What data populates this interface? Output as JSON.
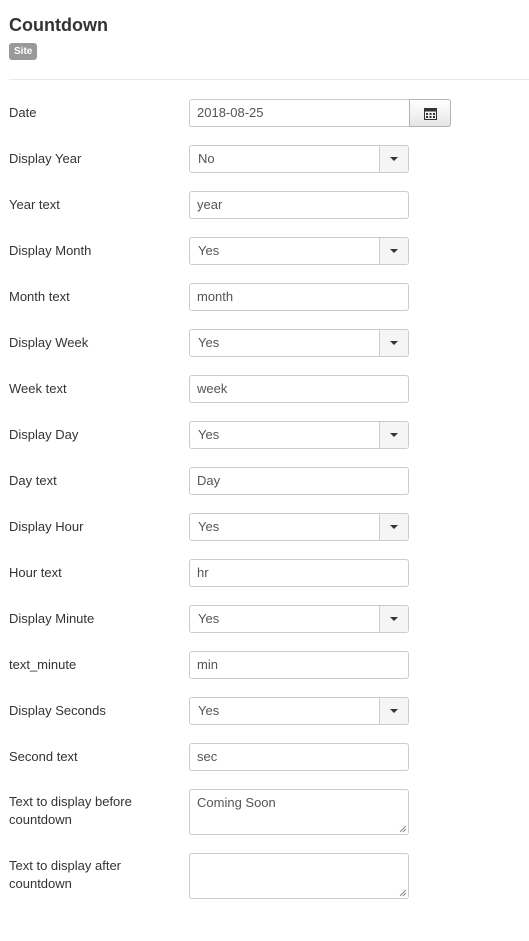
{
  "header": {
    "title": "Countdown",
    "badge": "Site"
  },
  "fields": {
    "date": {
      "label": "Date",
      "value": "2018-08-25"
    },
    "display_year": {
      "label": "Display Year",
      "value": "No"
    },
    "year_text": {
      "label": "Year text",
      "value": "year"
    },
    "display_month": {
      "label": "Display Month",
      "value": "Yes"
    },
    "month_text": {
      "label": "Month text",
      "value": "month"
    },
    "display_week": {
      "label": "Display Week",
      "value": "Yes"
    },
    "week_text": {
      "label": "Week text",
      "value": "week"
    },
    "display_day": {
      "label": "Display Day",
      "value": "Yes"
    },
    "day_text": {
      "label": "Day text",
      "value": "Day"
    },
    "display_hour": {
      "label": "Display Hour",
      "value": "Yes"
    },
    "hour_text": {
      "label": "Hour text",
      "value": "hr"
    },
    "display_minute": {
      "label": "Display Minute",
      "value": "Yes"
    },
    "text_minute": {
      "label": "text_minute",
      "value": "min"
    },
    "display_seconds": {
      "label": "Display Seconds",
      "value": "Yes"
    },
    "second_text": {
      "label": "Second text",
      "value": "sec"
    },
    "text_before": {
      "label_line1": "Text to display before",
      "label_line2": "countdown",
      "value": "Coming Soon"
    },
    "text_after": {
      "label_line1": "Text to display after",
      "label_line2": "countdown",
      "value": ""
    }
  },
  "icons": {
    "calendar": "calendar-icon",
    "dropdown": "chevron-down-icon"
  },
  "colors": {
    "badge_bg": "#999999",
    "border": "#cccccc",
    "text": "#333333"
  }
}
